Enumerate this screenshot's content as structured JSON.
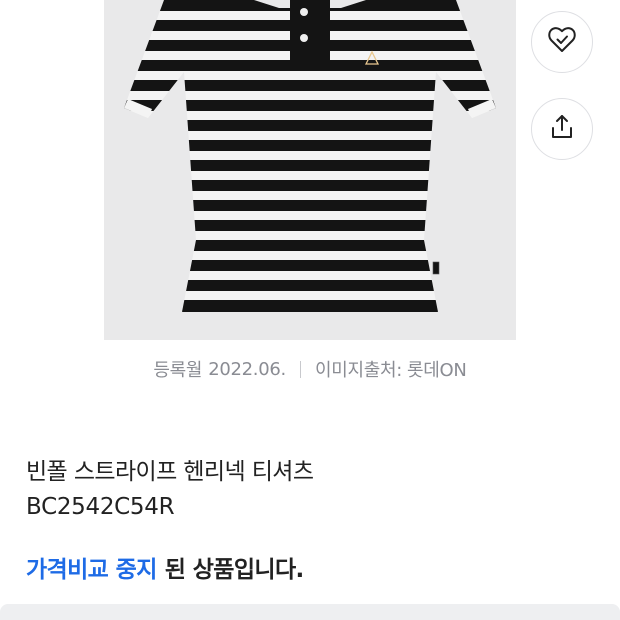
{
  "image": {
    "alt": "빈폴 스트라이프 헨리넥 티셔츠",
    "stripe_color": "#141414",
    "background_color": "#e9e9ea"
  },
  "actions": {
    "wishlist_icon": "heart-check-icon",
    "share_icon": "share-icon"
  },
  "meta": {
    "registered_label": "등록월",
    "registered_value": "2022.06.",
    "source_label": "이미지출처:",
    "source_value": "롯데ON"
  },
  "product": {
    "name": "빈폴 스트라이프 헨리넥 티셔츠",
    "model_code": "BC2542C54R"
  },
  "status": {
    "highlight": "가격비교 중지",
    "text": "된 상품입니다.",
    "highlight_color": "#1e6be6"
  }
}
